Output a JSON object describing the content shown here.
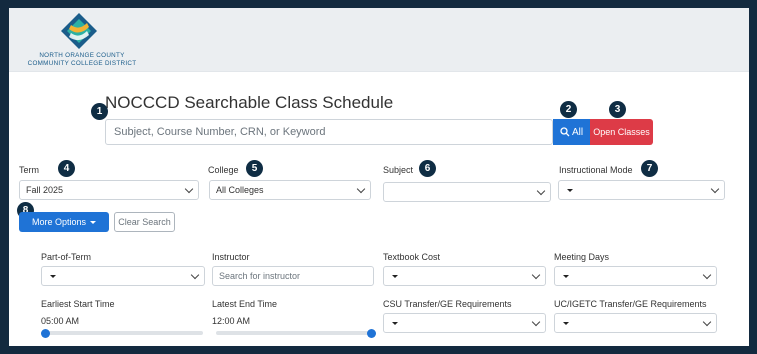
{
  "org": {
    "line1": "NORTH ORANGE COUNTY",
    "line2": "COMMUNITY COLLEGE DISTRICT"
  },
  "page": {
    "title": "NOCCCD Searchable Class Schedule"
  },
  "search": {
    "placeholder": "Subject, Course Number, CRN, or Keyword",
    "all_label": "All",
    "open_classes_label": "Open Classes"
  },
  "filters": {
    "term": {
      "label": "Term",
      "value": "Fall 2025"
    },
    "college": {
      "label": "College",
      "value": "All Colleges"
    },
    "subject": {
      "label": "Subject",
      "value": ""
    },
    "instructional_mode": {
      "label": "Instructional Mode",
      "value": ""
    }
  },
  "buttons": {
    "more_options": "More Options",
    "clear_search": "Clear Search"
  },
  "advanced": {
    "part_of_term": {
      "label": "Part-of-Term",
      "value": ""
    },
    "instructor": {
      "label": "Instructor",
      "placeholder": "Search for instructor"
    },
    "textbook_cost": {
      "label": "Textbook Cost",
      "value": ""
    },
    "meeting_days": {
      "label": "Meeting Days",
      "value": ""
    },
    "earliest_start": {
      "label": "Earliest Start Time",
      "value": "05:00 AM",
      "slider_position": 0.0
    },
    "latest_end": {
      "label": "Latest End Time",
      "value": "12:00 AM",
      "slider_position": 1.0
    },
    "csu_ge": {
      "label": "CSU Transfer/GE Requirements",
      "value": ""
    },
    "uc_igetc": {
      "label": "UC/IGETC Transfer/GE Requirements",
      "value": ""
    }
  },
  "badges": [
    "1",
    "2",
    "3",
    "4",
    "5",
    "6",
    "7",
    "8"
  ],
  "colors": {
    "primary": "#1f73d6",
    "danger": "#dd3b47",
    "badge": "#0f2d44",
    "background_frame": "#132a3f"
  },
  "icons": {
    "logo": "nocccd-logo-icon",
    "search": "search-icon",
    "dropdown": "chevron-down-icon"
  }
}
